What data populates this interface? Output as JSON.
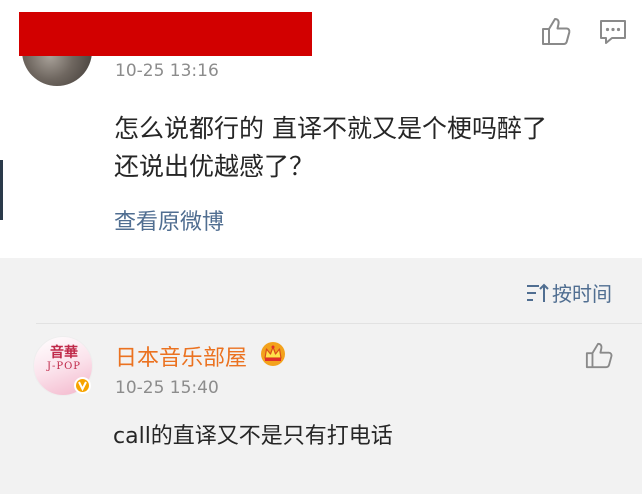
{
  "top_comment": {
    "timestamp": "10-25 13:16",
    "text_line1": "怎么说都行的 直译不就又是个梗吗醉了",
    "text_line2": "还说出优越感了？",
    "view_original_label": "查看原微博",
    "redaction_color": "#d20000"
  },
  "sort": {
    "label": "按时间",
    "icon": "sort-icon"
  },
  "reply": {
    "avatar_text_top": "音華",
    "avatar_text_bottom": "J-POP",
    "username": "日本音乐部屋",
    "timestamp": "10-25 15:40",
    "text": "call的直译又不是只有打电话",
    "badge_icon": "verified-badge-icon",
    "crown_icon": "crown-icon"
  },
  "colors": {
    "link": "#506e91",
    "username": "#eb7220",
    "secondary_text": "#8c8c8c",
    "primary_text": "#262626"
  }
}
